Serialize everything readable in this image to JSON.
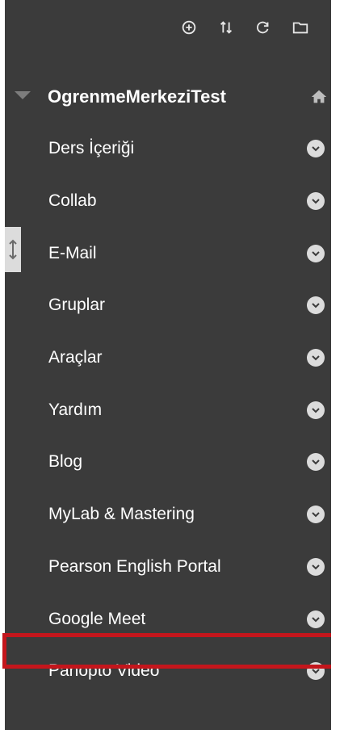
{
  "toolbar": {
    "icons": [
      "add-circle-icon",
      "sort-arrows-icon",
      "refresh-icon",
      "folder-icon"
    ]
  },
  "course": {
    "title": "OgrenmeMerkeziTest"
  },
  "menu": {
    "items": [
      {
        "label": "Ders İçeriği"
      },
      {
        "label": "Collab"
      },
      {
        "label": "E-Mail"
      },
      {
        "label": "Gruplar"
      },
      {
        "label": "Araçlar"
      },
      {
        "label": "Yardım"
      },
      {
        "label": "Blog"
      },
      {
        "label": "MyLab & Mastering"
      },
      {
        "label": "Pearson English Portal"
      },
      {
        "label": "Google Meet"
      },
      {
        "label": "Panopto Video"
      }
    ]
  },
  "colors": {
    "panel_background": "#3b3b3b",
    "text": "#ffffff",
    "highlight": "#c4161c",
    "chevron_bg": "#dcdcdc"
  }
}
